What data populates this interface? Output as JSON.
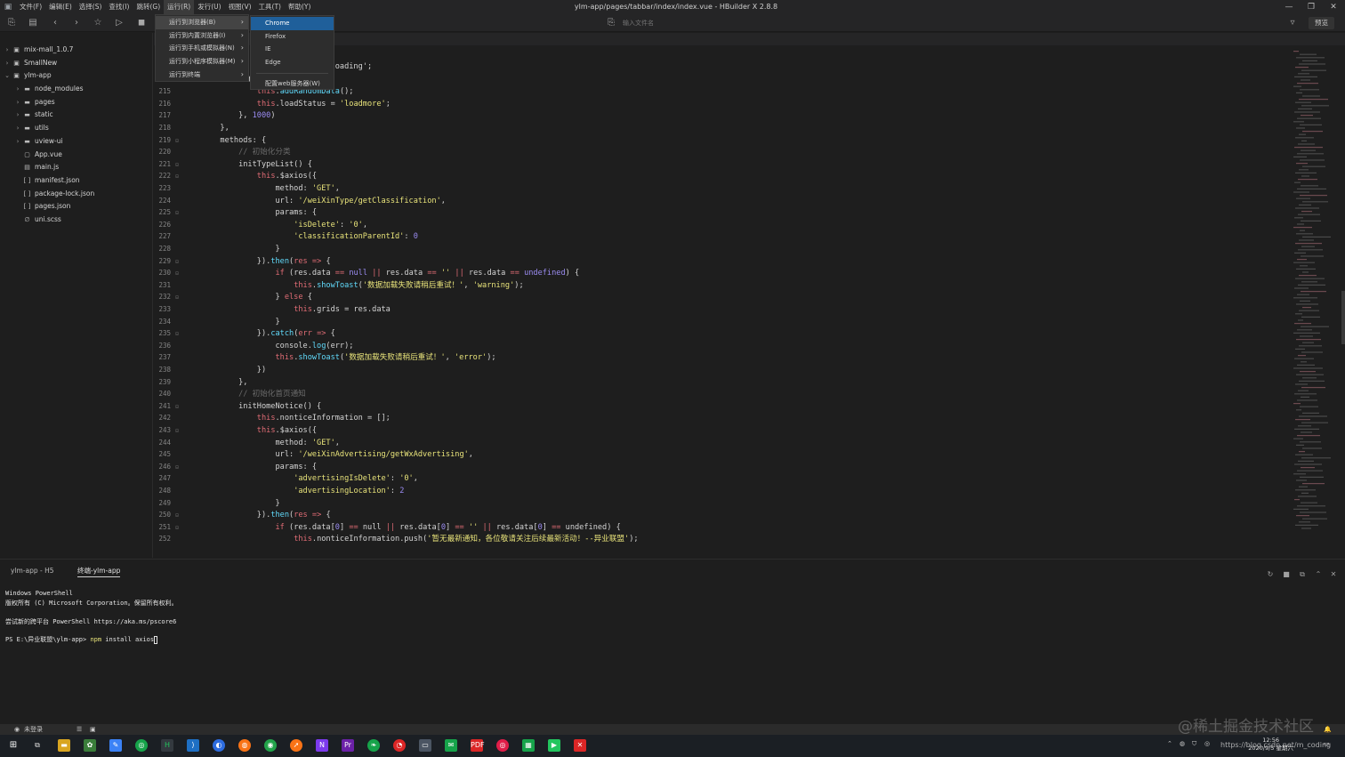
{
  "window": {
    "title": "ylm-app/pages/tabbar/index/index.vue - HBuilder X 2.8.8",
    "menus": [
      "文件(F)",
      "编辑(E)",
      "选择(S)",
      "查找(I)",
      "跳转(G)",
      "运行(R)",
      "发行(U)",
      "视图(V)",
      "工具(T)",
      "帮助(Y)"
    ],
    "controls": {
      "minimize": "—",
      "restore": "❐",
      "close": "✕"
    }
  },
  "toolbar": {
    "file_search_placeholder": "输入文件名",
    "preview_label": "预览"
  },
  "sidebar": {
    "items": [
      {
        "label": "mix-mall_1.0.7",
        "chevron": "›",
        "icon": "▣",
        "depth": 0
      },
      {
        "label": "SmallNew",
        "chevron": "›",
        "icon": "▣",
        "depth": 0
      },
      {
        "label": "ylm-app",
        "chevron": "⌄",
        "icon": "▣",
        "depth": 0
      },
      {
        "label": "node_modules",
        "chevron": "›",
        "icon": "▬",
        "depth": 1
      },
      {
        "label": "pages",
        "chevron": "›",
        "icon": "▬",
        "depth": 1
      },
      {
        "label": "static",
        "chevron": "›",
        "icon": "▬",
        "depth": 1
      },
      {
        "label": "utils",
        "chevron": "›",
        "icon": "▬",
        "depth": 1
      },
      {
        "label": "uview-ui",
        "chevron": "›",
        "icon": "▬",
        "depth": 1
      },
      {
        "label": "App.vue",
        "chevron": "",
        "icon": "▢",
        "depth": 1
      },
      {
        "label": "main.js",
        "chevron": "",
        "icon": "▤",
        "depth": 1
      },
      {
        "label": "manifest.json",
        "chevron": "",
        "icon": "[ ]",
        "depth": 1
      },
      {
        "label": "package-lock.json",
        "chevron": "",
        "icon": "[ ]",
        "depth": 1
      },
      {
        "label": "pages.json",
        "chevron": "",
        "icon": "[ ]",
        "depth": 1
      },
      {
        "label": "uni.scss",
        "chevron": "",
        "icon": "∅",
        "depth": 1
      }
    ]
  },
  "run_menu": {
    "items": [
      {
        "label": "运行到浏览器(B)",
        "active": true
      },
      {
        "label": "运行到内置浏览器(I)",
        "active": false
      },
      {
        "label": "运行到手机或模拟器(N)",
        "active": false
      },
      {
        "label": "运行到小程序模拟器(M)",
        "active": false
      },
      {
        "label": "运行到终端",
        "active": false
      }
    ],
    "arrow": "›"
  },
  "browser_menu": {
    "items": [
      "Chrome",
      "Firefox",
      "IE",
      "Edge"
    ],
    "config_item": "配置web服务器(W)"
  },
  "editor": {
    "code": [
      {
        "n": "",
        "fold": "",
        "text": [
          [
            "code",
            "                                 oading';"
          ]
        ]
      },
      {
        "n": "214",
        "fold": "⊟",
        "text": [
          [
            "code",
            "            setTimeout(() "
          ],
          [
            "op",
            "=>"
          ],
          [
            "code",
            " {"
          ]
        ]
      },
      {
        "n": "215",
        "fold": "",
        "text": [
          [
            "code",
            "                "
          ],
          [
            "kw",
            "this"
          ],
          [
            "code",
            "."
          ],
          [
            "fn",
            "addRandomData"
          ],
          [
            "code",
            "();"
          ]
        ]
      },
      {
        "n": "216",
        "fold": "",
        "text": [
          [
            "code",
            "                "
          ],
          [
            "kw",
            "this"
          ],
          [
            "code",
            ".loadStatus = "
          ],
          [
            "str",
            "'loadmore'"
          ],
          [
            "code",
            ";"
          ]
        ]
      },
      {
        "n": "217",
        "fold": "",
        "text": [
          [
            "code",
            "            }, "
          ],
          [
            "num",
            "1000"
          ],
          [
            "code",
            ")"
          ]
        ]
      },
      {
        "n": "218",
        "fold": "",
        "text": [
          [
            "code",
            "        },"
          ]
        ]
      },
      {
        "n": "219",
        "fold": "⊟",
        "text": [
          [
            "code",
            "        methods: {"
          ]
        ]
      },
      {
        "n": "220",
        "fold": "",
        "text": [
          [
            "cm",
            "            // 初始化分类"
          ]
        ]
      },
      {
        "n": "221",
        "fold": "⊟",
        "text": [
          [
            "code",
            "            initTypeList() {"
          ]
        ]
      },
      {
        "n": "222",
        "fold": "⊟",
        "text": [
          [
            "code",
            "                "
          ],
          [
            "kw",
            "this"
          ],
          [
            "code",
            ".$axios({"
          ]
        ]
      },
      {
        "n": "223",
        "fold": "",
        "text": [
          [
            "code",
            "                    method: "
          ],
          [
            "str",
            "'GET'"
          ],
          [
            "code",
            ","
          ]
        ]
      },
      {
        "n": "224",
        "fold": "",
        "text": [
          [
            "code",
            "                    url: "
          ],
          [
            "str",
            "'/weiXinType/getClassification'"
          ],
          [
            "code",
            ","
          ]
        ]
      },
      {
        "n": "225",
        "fold": "⊟",
        "text": [
          [
            "code",
            "                    params: {"
          ]
        ]
      },
      {
        "n": "226",
        "fold": "",
        "text": [
          [
            "code",
            "                        "
          ],
          [
            "str",
            "'isDelete'"
          ],
          [
            "code",
            ": "
          ],
          [
            "str",
            "'0'"
          ],
          [
            "code",
            ","
          ]
        ]
      },
      {
        "n": "227",
        "fold": "",
        "text": [
          [
            "code",
            "                        "
          ],
          [
            "str",
            "'classificationParentId'"
          ],
          [
            "code",
            ": "
          ],
          [
            "num",
            "0"
          ]
        ]
      },
      {
        "n": "228",
        "fold": "",
        "text": [
          [
            "code",
            "                    }"
          ]
        ]
      },
      {
        "n": "229",
        "fold": "⊟",
        "text": [
          [
            "code",
            "                })."
          ],
          [
            "fn",
            "then"
          ],
          [
            "code",
            "("
          ],
          [
            "kw",
            "res"
          ],
          [
            "code",
            " "
          ],
          [
            "op",
            "=>"
          ],
          [
            "code",
            " {"
          ]
        ]
      },
      {
        "n": "230",
        "fold": "⊟",
        "text": [
          [
            "code",
            "                    "
          ],
          [
            "kw",
            "if"
          ],
          [
            "code",
            " (res.data "
          ],
          [
            "op",
            "=="
          ],
          [
            "code",
            " "
          ],
          [
            "num",
            "null"
          ],
          [
            "code",
            " "
          ],
          [
            "op",
            "||"
          ],
          [
            "code",
            " res.data "
          ],
          [
            "op",
            "=="
          ],
          [
            "code",
            " "
          ],
          [
            "str",
            "''"
          ],
          [
            "code",
            " "
          ],
          [
            "op",
            "||"
          ],
          [
            "code",
            " res.data "
          ],
          [
            "op",
            "=="
          ],
          [
            "code",
            " "
          ],
          [
            "num",
            "undefined"
          ],
          [
            "code",
            ") {"
          ]
        ]
      },
      {
        "n": "231",
        "fold": "",
        "text": [
          [
            "code",
            "                        "
          ],
          [
            "kw",
            "this"
          ],
          [
            "code",
            "."
          ],
          [
            "fn",
            "showToast"
          ],
          [
            "code",
            "("
          ],
          [
            "str",
            "'数据加载失败请稍后重试！'"
          ],
          [
            "code",
            ", "
          ],
          [
            "str",
            "'warning'"
          ],
          [
            "code",
            ");"
          ]
        ]
      },
      {
        "n": "232",
        "fold": "⊟",
        "text": [
          [
            "code",
            "                    } "
          ],
          [
            "kw",
            "else"
          ],
          [
            "code",
            " {"
          ]
        ]
      },
      {
        "n": "233",
        "fold": "",
        "text": [
          [
            "code",
            "                        "
          ],
          [
            "kw",
            "this"
          ],
          [
            "code",
            ".grids = res.data"
          ]
        ]
      },
      {
        "n": "234",
        "fold": "",
        "text": [
          [
            "code",
            "                    }"
          ]
        ]
      },
      {
        "n": "235",
        "fold": "⊟",
        "text": [
          [
            "code",
            "                })."
          ],
          [
            "fn",
            "catch"
          ],
          [
            "code",
            "("
          ],
          [
            "kw",
            "err"
          ],
          [
            "code",
            " "
          ],
          [
            "op",
            "=>"
          ],
          [
            "code",
            " {"
          ]
        ]
      },
      {
        "n": "236",
        "fold": "",
        "text": [
          [
            "code",
            "                    console."
          ],
          [
            "fn",
            "log"
          ],
          [
            "code",
            "(err);"
          ]
        ]
      },
      {
        "n": "237",
        "fold": "",
        "text": [
          [
            "code",
            "                    "
          ],
          [
            "kw",
            "this"
          ],
          [
            "code",
            "."
          ],
          [
            "fn",
            "showToast"
          ],
          [
            "code",
            "("
          ],
          [
            "str",
            "'数据加载失败请稍后重试！'"
          ],
          [
            "code",
            ", "
          ],
          [
            "str",
            "'error'"
          ],
          [
            "code",
            ");"
          ]
        ]
      },
      {
        "n": "238",
        "fold": "",
        "text": [
          [
            "code",
            "                })"
          ]
        ]
      },
      {
        "n": "239",
        "fold": "",
        "text": [
          [
            "code",
            "            },"
          ]
        ]
      },
      {
        "n": "240",
        "fold": "",
        "text": [
          [
            "cm",
            "            // 初始化首页通知"
          ]
        ]
      },
      {
        "n": "241",
        "fold": "⊟",
        "text": [
          [
            "code",
            "            initHomeNotice() {"
          ]
        ]
      },
      {
        "n": "242",
        "fold": "",
        "text": [
          [
            "code",
            "                "
          ],
          [
            "kw",
            "this"
          ],
          [
            "code",
            ".nonticeInformation = [];"
          ]
        ]
      },
      {
        "n": "243",
        "fold": "⊟",
        "text": [
          [
            "code",
            "                "
          ],
          [
            "kw",
            "this"
          ],
          [
            "code",
            ".$axios({"
          ]
        ]
      },
      {
        "n": "244",
        "fold": "",
        "text": [
          [
            "code",
            "                    method: "
          ],
          [
            "str",
            "'GET'"
          ],
          [
            "code",
            ","
          ]
        ]
      },
      {
        "n": "245",
        "fold": "",
        "text": [
          [
            "code",
            "                    url: "
          ],
          [
            "str",
            "'/weiXinAdvertising/getWxAdvertising'"
          ],
          [
            "code",
            ","
          ]
        ]
      },
      {
        "n": "246",
        "fold": "⊟",
        "text": [
          [
            "code",
            "                    params: {"
          ]
        ]
      },
      {
        "n": "247",
        "fold": "",
        "text": [
          [
            "code",
            "                        "
          ],
          [
            "str",
            "'advertisingIsDelete'"
          ],
          [
            "code",
            ": "
          ],
          [
            "str",
            "'0'"
          ],
          [
            "code",
            ","
          ]
        ]
      },
      {
        "n": "248",
        "fold": "",
        "text": [
          [
            "code",
            "                        "
          ],
          [
            "str",
            "'advertisingLocation'"
          ],
          [
            "code",
            ": "
          ],
          [
            "num",
            "2"
          ]
        ]
      },
      {
        "n": "249",
        "fold": "",
        "text": [
          [
            "code",
            "                    }"
          ]
        ]
      },
      {
        "n": "250",
        "fold": "⊟",
        "text": [
          [
            "code",
            "                })."
          ],
          [
            "fn",
            "then"
          ],
          [
            "code",
            "("
          ],
          [
            "kw",
            "res"
          ],
          [
            "code",
            " "
          ],
          [
            "op",
            "=>"
          ],
          [
            "code",
            " {"
          ]
        ]
      },
      {
        "n": "251",
        "fold": "⊟",
        "text": [
          [
            "code",
            "                    "
          ],
          [
            "kw",
            "if"
          ],
          [
            "code",
            " (res.data["
          ],
          [
            "num",
            "0"
          ],
          [
            "code",
            "] "
          ],
          [
            "op",
            "=="
          ],
          [
            "code",
            " null "
          ],
          [
            "op",
            "||"
          ],
          [
            "code",
            " res.data["
          ],
          [
            "num",
            "0"
          ],
          [
            "code",
            "] "
          ],
          [
            "op",
            "=="
          ],
          [
            "code",
            " "
          ],
          [
            "str",
            "''"
          ],
          [
            "code",
            " "
          ],
          [
            "op",
            "||"
          ],
          [
            "code",
            " res.data["
          ],
          [
            "num",
            "0"
          ],
          [
            "code",
            "] "
          ],
          [
            "op",
            "=="
          ],
          [
            "code",
            " undefined) {"
          ]
        ]
      },
      {
        "n": "252",
        "fold": "",
        "text": [
          [
            "code",
            "                        "
          ],
          [
            "kw",
            "this"
          ],
          [
            "code",
            ".nonticeInformation.push("
          ],
          [
            "str",
            "'暂无最新通知，各位敬请关注后续最新活动！--异业联盟'"
          ],
          [
            "code",
            ");"
          ]
        ]
      }
    ]
  },
  "terminal": {
    "tabs": [
      "ylm-app - H5",
      "终端-ylm-app"
    ],
    "lines": [
      "Windows PowerShell",
      "版权所有 (C) Microsoft Corporation。保留所有权利。",
      "",
      "尝试新的跨平台 PowerShell https://aka.ms/pscore6",
      ""
    ],
    "prompt": "PS E:\\异业联盟\\ylm-app> ",
    "command": "npm",
    "command_args": " install axios"
  },
  "statusbar": {
    "login": "未登录"
  },
  "taskbar": {
    "time": "12:56",
    "date": "2020/9/5 星期六",
    "watermark": "@稀土掘金技术社区",
    "blog_url": "https://blog.csdn.net/m_coding"
  },
  "colors": {
    "menu_highlight": "#1f5f9a",
    "keyword": "#e06c75",
    "string": "#e8e37a",
    "number": "#9b8cf2",
    "function": "#61dafb"
  }
}
